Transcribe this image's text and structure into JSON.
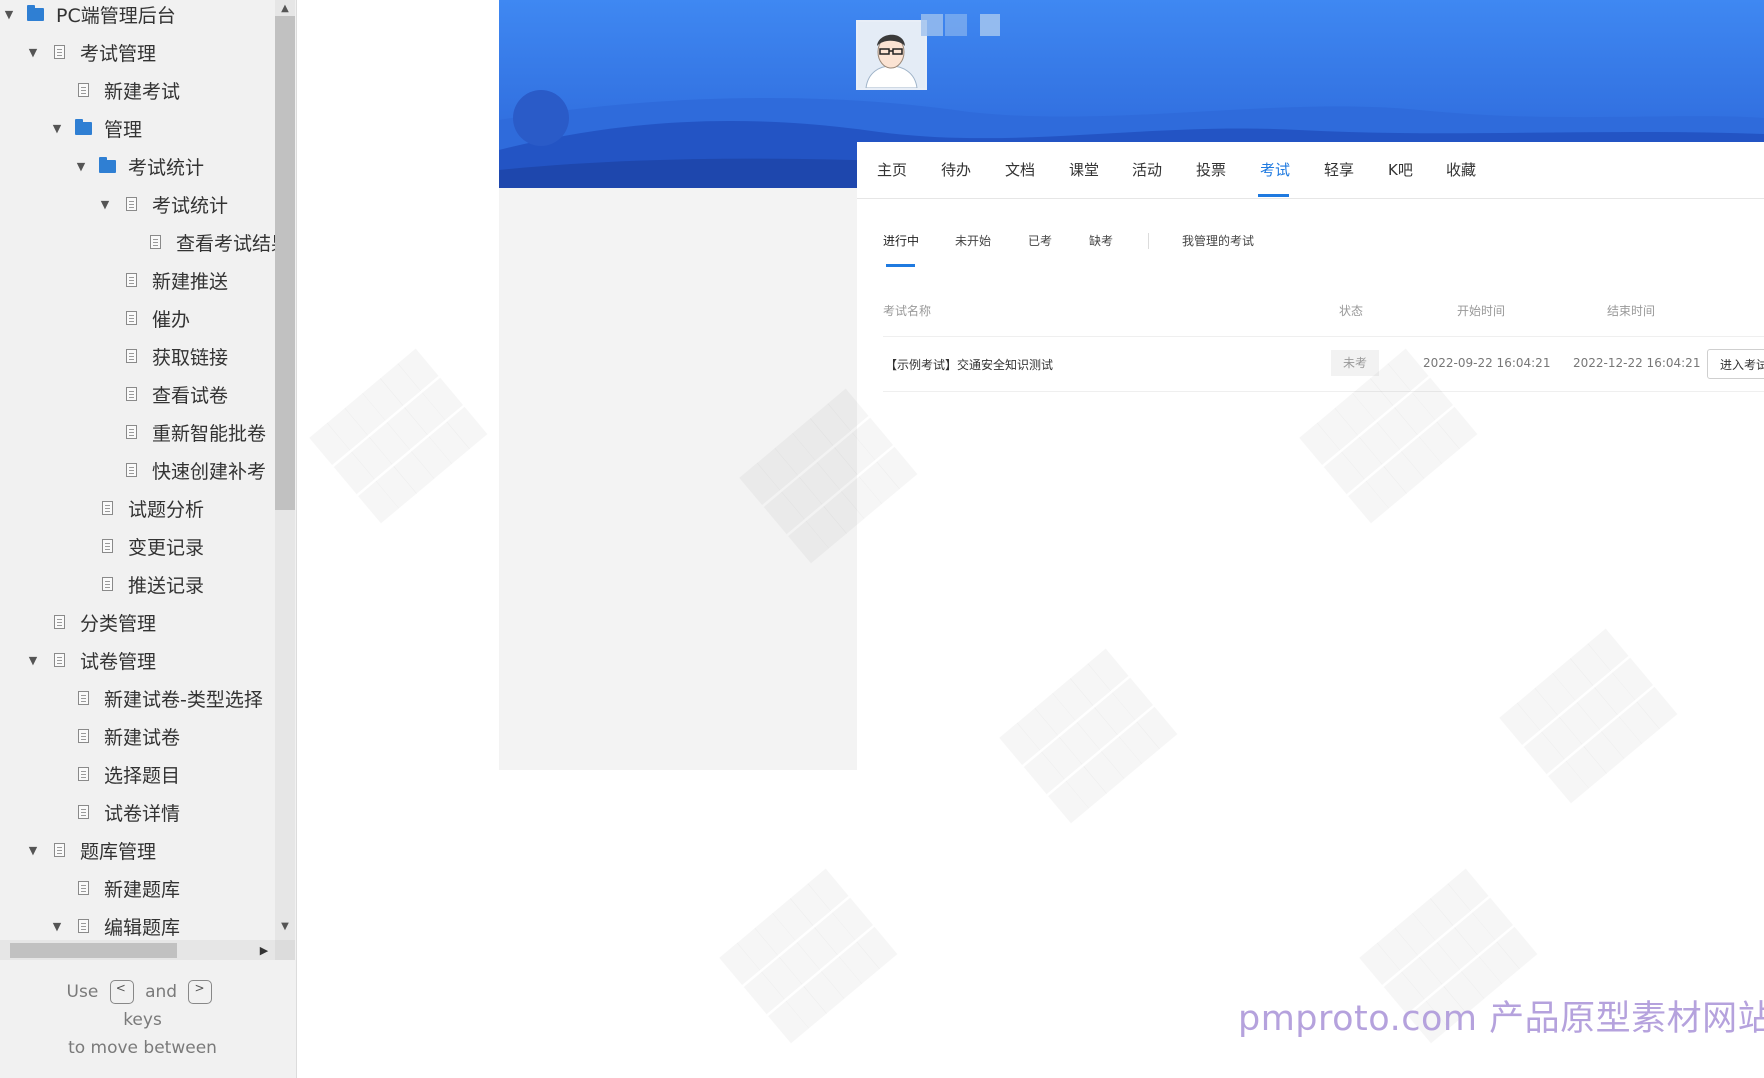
{
  "sidebar": {
    "tree": [
      {
        "label": "PC端管理后台",
        "icon": "folder-icon",
        "expanded": true
      },
      {
        "label": "考试管理",
        "icon": "page-icon",
        "expanded": true
      },
      {
        "label": "新建考试",
        "icon": "page-icon",
        "expanded": null
      },
      {
        "label": "管理",
        "icon": "folder-icon",
        "expanded": true
      },
      {
        "label": "考试统计",
        "icon": "folder-icon",
        "expanded": true
      },
      {
        "label": "考试统计",
        "icon": "page-icon",
        "expanded": true
      },
      {
        "label": "查看考试结果",
        "icon": "page-icon",
        "expanded": null
      },
      {
        "label": "新建推送",
        "icon": "page-icon",
        "expanded": null
      },
      {
        "label": "催办",
        "icon": "page-icon",
        "expanded": null
      },
      {
        "label": "获取链接",
        "icon": "page-icon",
        "expanded": null
      },
      {
        "label": "查看试卷",
        "icon": "page-icon",
        "expanded": null
      },
      {
        "label": "重新智能批卷",
        "icon": "page-icon",
        "expanded": null
      },
      {
        "label": "快速创建补考",
        "icon": "page-icon",
        "expanded": null
      },
      {
        "label": "试题分析",
        "icon": "page-icon",
        "expanded": null
      },
      {
        "label": "变更记录",
        "icon": "page-icon",
        "expanded": null
      },
      {
        "label": "推送记录",
        "icon": "page-icon",
        "expanded": null
      },
      {
        "label": "分类管理",
        "icon": "page-icon",
        "expanded": null
      },
      {
        "label": "试卷管理",
        "icon": "page-icon",
        "expanded": true
      },
      {
        "label": "新建试卷-类型选择",
        "icon": "page-icon",
        "expanded": null
      },
      {
        "label": "新建试卷",
        "icon": "page-icon",
        "expanded": null
      },
      {
        "label": "选择题目",
        "icon": "page-icon",
        "expanded": null
      },
      {
        "label": "试卷详情",
        "icon": "page-icon",
        "expanded": null
      },
      {
        "label": "题库管理",
        "icon": "page-icon",
        "expanded": true
      },
      {
        "label": "新建题库",
        "icon": "page-icon",
        "expanded": null
      },
      {
        "label": "编辑题库",
        "icon": "page-icon",
        "expanded": true
      }
    ],
    "hint": {
      "use": "Use",
      "key_prev": "<",
      "and": "and",
      "key_next": ">",
      "keys": "keys",
      "to_move": "to move between"
    }
  },
  "prototype": {
    "nav_tabs": [
      "主页",
      "待办",
      "文档",
      "课堂",
      "活动",
      "投票",
      "考试",
      "轻享",
      "K吧",
      "收藏"
    ],
    "active_nav": "考试",
    "sub_tabs": [
      "进行中",
      "未开始",
      "已考",
      "缺考",
      "我管理的考试"
    ],
    "active_sub_tab": "进行中",
    "table": {
      "headers": [
        "考试名称",
        "状态",
        "开始时间",
        "结束时间"
      ],
      "rows": [
        {
          "name": "【示例考试】交通安全知识测试",
          "status": "未考",
          "start": "2022-09-22 16:04:21",
          "end": "2022-12-22 16:04:21",
          "action": "进入考试"
        }
      ]
    }
  },
  "watermark": {
    "site": "pmproto.com 产品原型素材网站"
  },
  "colors": {
    "accent": "#1f7ae0",
    "folder": "#2f7fd3",
    "banner_top": "#3d86f0",
    "watermark_text": "#b5a2dd"
  }
}
